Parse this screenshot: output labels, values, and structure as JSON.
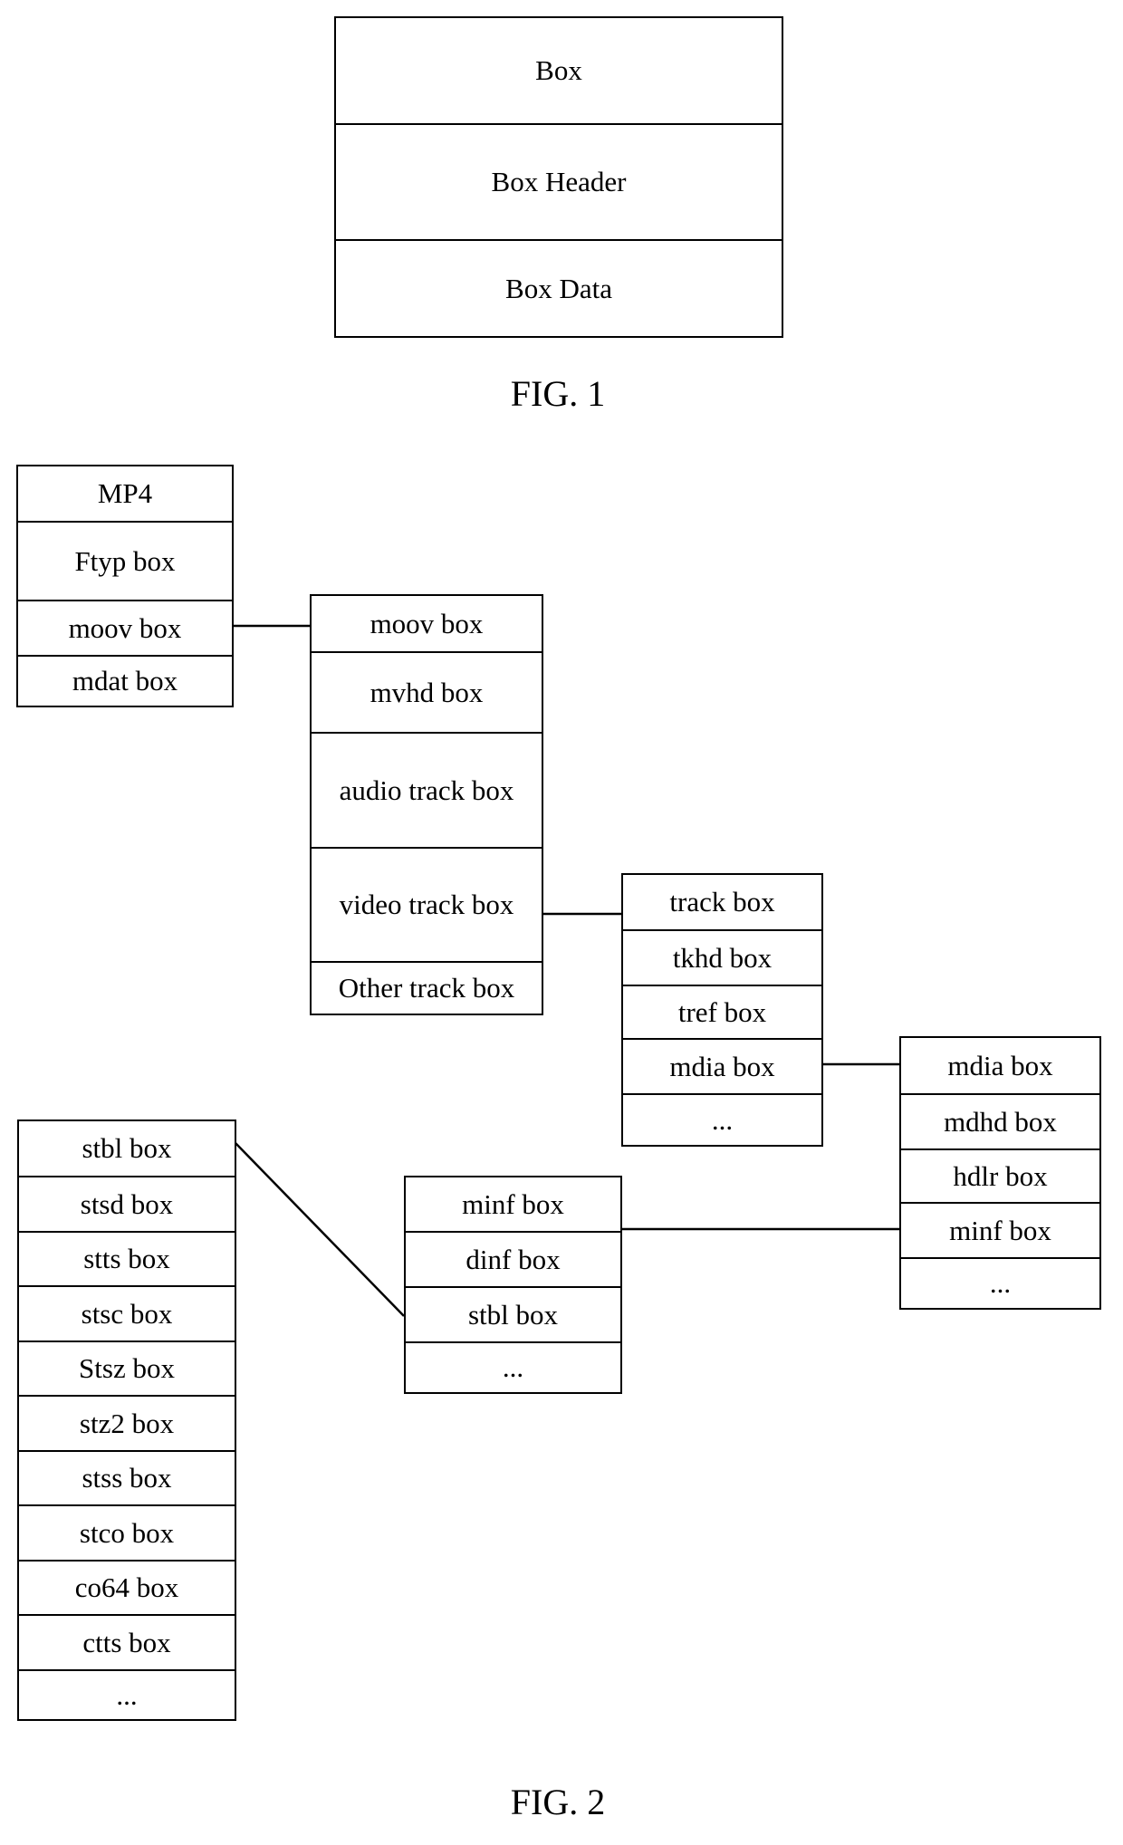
{
  "fig1": {
    "label": "FIG. 1",
    "box": {
      "cells": [
        "Box",
        "Box Header",
        "Box Data"
      ]
    }
  },
  "fig2": {
    "label": "FIG. 2",
    "mp4": {
      "cells": [
        "MP4",
        "Ftyp box",
        "moov box",
        "mdat box"
      ]
    },
    "moov": {
      "cells": [
        "moov box",
        "mvhd box",
        "audio track box",
        "video track box",
        "Other track box"
      ]
    },
    "track": {
      "cells": [
        "track box",
        "tkhd box",
        "tref box",
        "mdia box",
        "..."
      ]
    },
    "mdia": {
      "cells": [
        "mdia box",
        "mdhd box",
        "hdlr box",
        "minf box",
        "..."
      ]
    },
    "minf": {
      "cells": [
        "minf box",
        "dinf box",
        "stbl box",
        "..."
      ]
    },
    "stbl": {
      "cells": [
        "stbl box",
        "stsd box",
        "stts box",
        "stsc box",
        "Stsz box",
        "stz2 box",
        "stss box",
        "stco box",
        "co64 box",
        "ctts box",
        "..."
      ]
    },
    "connections": [
      {
        "from": "mp4: moov box",
        "to": "moov"
      },
      {
        "from": "moov: video track box",
        "to": "track"
      },
      {
        "from": "track: mdia box",
        "to": "mdia"
      },
      {
        "from": "mdia: minf box",
        "to": "minf"
      },
      {
        "from": "minf: stbl box",
        "to": "stbl"
      }
    ]
  }
}
